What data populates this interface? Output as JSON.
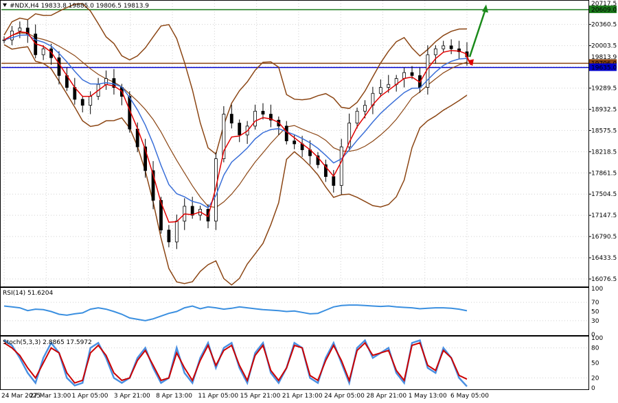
{
  "header": {
    "symbol_line": "#NDX,H4  19833.8 19885.0 19806.5 19813.9"
  },
  "price_labels": {
    "top_cut": "20717.5",
    "green_level": "20609.0",
    "current_price": "19813.9",
    "brown_level": "19706.0",
    "blue_level": "19635.0"
  },
  "colors": {
    "candle": "#000000",
    "bollinger": "#8B4513",
    "ema_fast": "#e00000",
    "ema_slow": "#3a6fd8",
    "green_line": "#1a7a1a",
    "blue_line": "#0000cc",
    "rsi_line": "#3a8fe0",
    "stoch_main": "#4a90e2",
    "stoch_signal": "#cc0000",
    "arrow_up": "#1a8a1a",
    "arrow_down": "#e00000"
  },
  "rsi_panel": {
    "label": "RSI(14) 51.6204",
    "ticks": [
      "100",
      "70",
      "50",
      "30",
      "0"
    ]
  },
  "stoch_panel": {
    "label": "Stoch(5,3,3) 2.8865 17.5972",
    "ticks": [
      "100",
      "80",
      "50",
      "20",
      "0"
    ]
  },
  "chart_data": {
    "type": "line",
    "title": "#NDX,H4",
    "y_ticks": [
      "20360.5",
      "20003.5",
      "19646.5",
      "19289.5",
      "18932.5",
      "18575.5",
      "18218.5",
      "17861.5",
      "17504.5",
      "17147.5",
      "16790.5",
      "16433.5",
      "16076.5"
    ],
    "ylim": [
      15950,
      20760
    ],
    "x_labels": [
      "24 Mar 2025",
      "27 Mar 13:00",
      "1 Apr 05:00",
      "3 Apr 21:00",
      "8 Apr 13:00",
      "11 Apr 05:00",
      "15 Apr 21:00",
      "21 Apr 13:00",
      "24 Apr 05:00",
      "28 Apr 21:00",
      "1 May 13:00",
      "6 May 05:00"
    ],
    "horizontal_levels": [
      {
        "price": 20609.0,
        "color": "green"
      },
      {
        "price": 19706.0,
        "color": "brown"
      },
      {
        "price": 19635.0,
        "color": "blue"
      }
    ],
    "series": [
      {
        "name": "close",
        "values": [
          20100,
          20250,
          20300,
          20200,
          19850,
          19950,
          19800,
          19500,
          19300,
          19100,
          19000,
          19150,
          19350,
          19450,
          19300,
          19150,
          18600,
          18300,
          17900,
          17400,
          16900,
          16700,
          17050,
          17300,
          17150,
          17250,
          17050,
          18100,
          18850,
          18700,
          18500,
          18650,
          18900,
          18850,
          18750,
          18650,
          18400,
          18350,
          18250,
          18150,
          18000,
          17800,
          17650,
          18300,
          18700,
          18900,
          19000,
          19200,
          19300,
          19350,
          19450,
          19550,
          19500,
          19300,
          19850,
          19950,
          20000,
          19950,
          19900,
          19813.9
        ]
      }
    ],
    "rsi": [
      62,
      60,
      58,
      52,
      55,
      54,
      50,
      44,
      42,
      45,
      47,
      55,
      58,
      55,
      50,
      44,
      36,
      33,
      30,
      34,
      40,
      46,
      50,
      58,
      62,
      56,
      60,
      58,
      55,
      57,
      60,
      58,
      56,
      54,
      53,
      52,
      50,
      51,
      48,
      45,
      46,
      53,
      60,
      63,
      64,
      64,
      63,
      62,
      61,
      62,
      60,
      59,
      58,
      56,
      57,
      58,
      58,
      57,
      55,
      51.6
    ],
    "stoch_k": [
      95,
      85,
      60,
      30,
      10,
      60,
      90,
      70,
      20,
      5,
      10,
      80,
      90,
      60,
      20,
      10,
      20,
      60,
      80,
      40,
      10,
      20,
      80,
      30,
      10,
      60,
      90,
      40,
      80,
      90,
      40,
      10,
      70,
      90,
      30,
      10,
      40,
      90,
      80,
      20,
      10,
      60,
      90,
      50,
      10,
      80,
      95,
      60,
      70,
      80,
      30,
      10,
      90,
      95,
      40,
      30,
      80,
      60,
      20,
      3
    ],
    "stoch_d": [
      90,
      80,
      65,
      40,
      20,
      50,
      80,
      70,
      30,
      10,
      15,
      70,
      85,
      65,
      30,
      15,
      20,
      55,
      75,
      45,
      15,
      20,
      70,
      40,
      15,
      55,
      85,
      45,
      75,
      85,
      45,
      15,
      65,
      85,
      35,
      15,
      40,
      85,
      80,
      25,
      15,
      55,
      85,
      55,
      15,
      75,
      90,
      65,
      70,
      75,
      35,
      15,
      85,
      90,
      45,
      35,
      75,
      60,
      25,
      17.6
    ]
  }
}
